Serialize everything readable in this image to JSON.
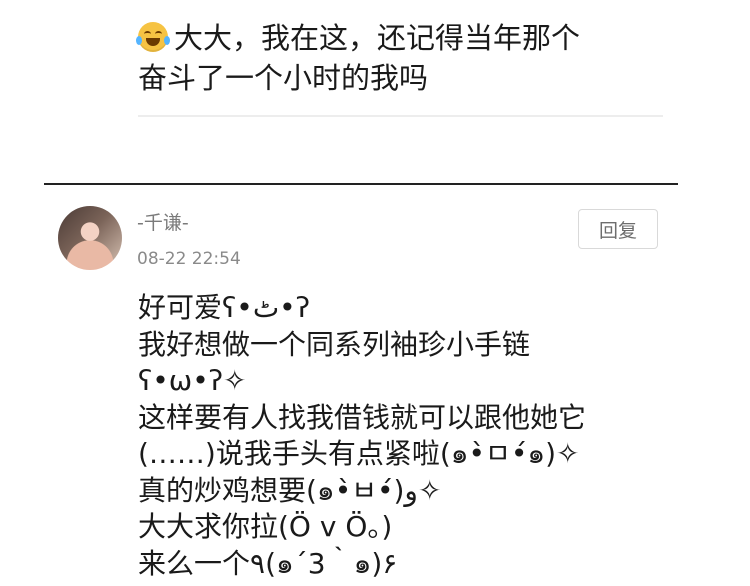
{
  "top_comment": {
    "emoji": "laughing-tears-emoji",
    "line1": "大大，我在这，还记得当年那个",
    "line2": "奋斗了一个小时的我吗"
  },
  "comment": {
    "username": "-千谦-",
    "timestamp": "08-22 22:54",
    "reply_label": "回复",
    "lines": [
      "好可爱ʕ•ٹ•ʔ",
      "我好想做一个同系列袖珍小手链",
      "ʕ•ω•ʔ✧",
      "这样要有人找我借钱就可以跟他她它",
      "(……)说我手头有点紧啦(๑•̀ㅁ•́๑)✧",
      "真的炒鸡想要(๑•̀ㅂ•́)و✧",
      "大大求你拉(Ö v Ö。)",
      "来么一个٩(๑´3｀๑)۶"
    ]
  },
  "colors": {
    "divider_thin": "#ededed",
    "divider_thick": "#222222",
    "meta_text": "#8a8a8a"
  }
}
